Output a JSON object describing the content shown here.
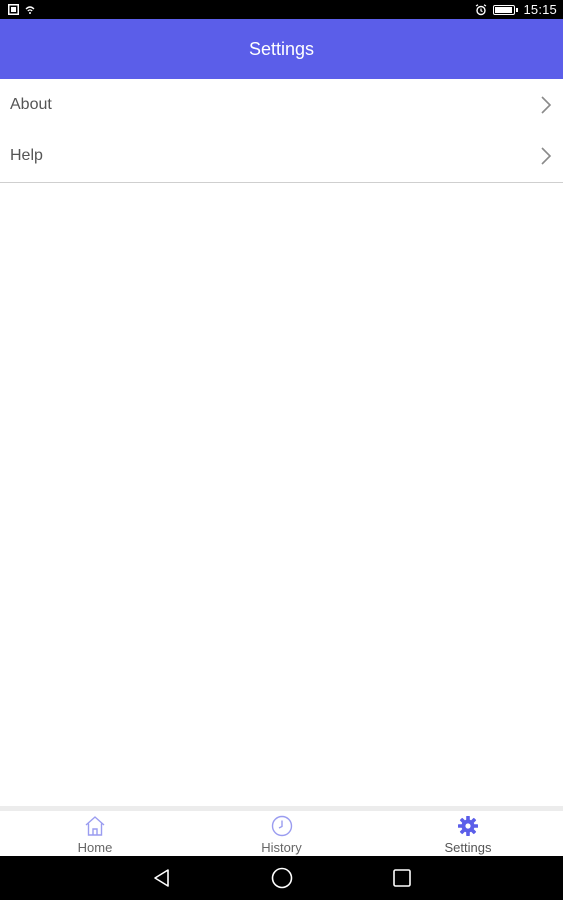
{
  "status_bar": {
    "time": "15:15",
    "battery_level": 0.85,
    "icons": [
      "screenshot-icon",
      "wifi-icon",
      "alarm-icon",
      "battery-icon"
    ]
  },
  "header": {
    "title": "Settings"
  },
  "settings_list": [
    {
      "label": "About",
      "icon": "chevron-right-icon"
    },
    {
      "label": "Help",
      "icon": "chevron-right-icon"
    }
  ],
  "tab_bar": {
    "tabs": [
      {
        "label": "Home",
        "icon": "home-icon",
        "active": false
      },
      {
        "label": "History",
        "icon": "clock-icon",
        "active": false
      },
      {
        "label": "Settings",
        "icon": "gear-icon",
        "active": true
      }
    ]
  },
  "colors": {
    "accent": "#5b5ee9",
    "text": "#555555",
    "inactive_icon": "#9a9cf0"
  },
  "nav_bar": {
    "icons": [
      "back-icon",
      "home-circle-icon",
      "recents-icon"
    ]
  }
}
